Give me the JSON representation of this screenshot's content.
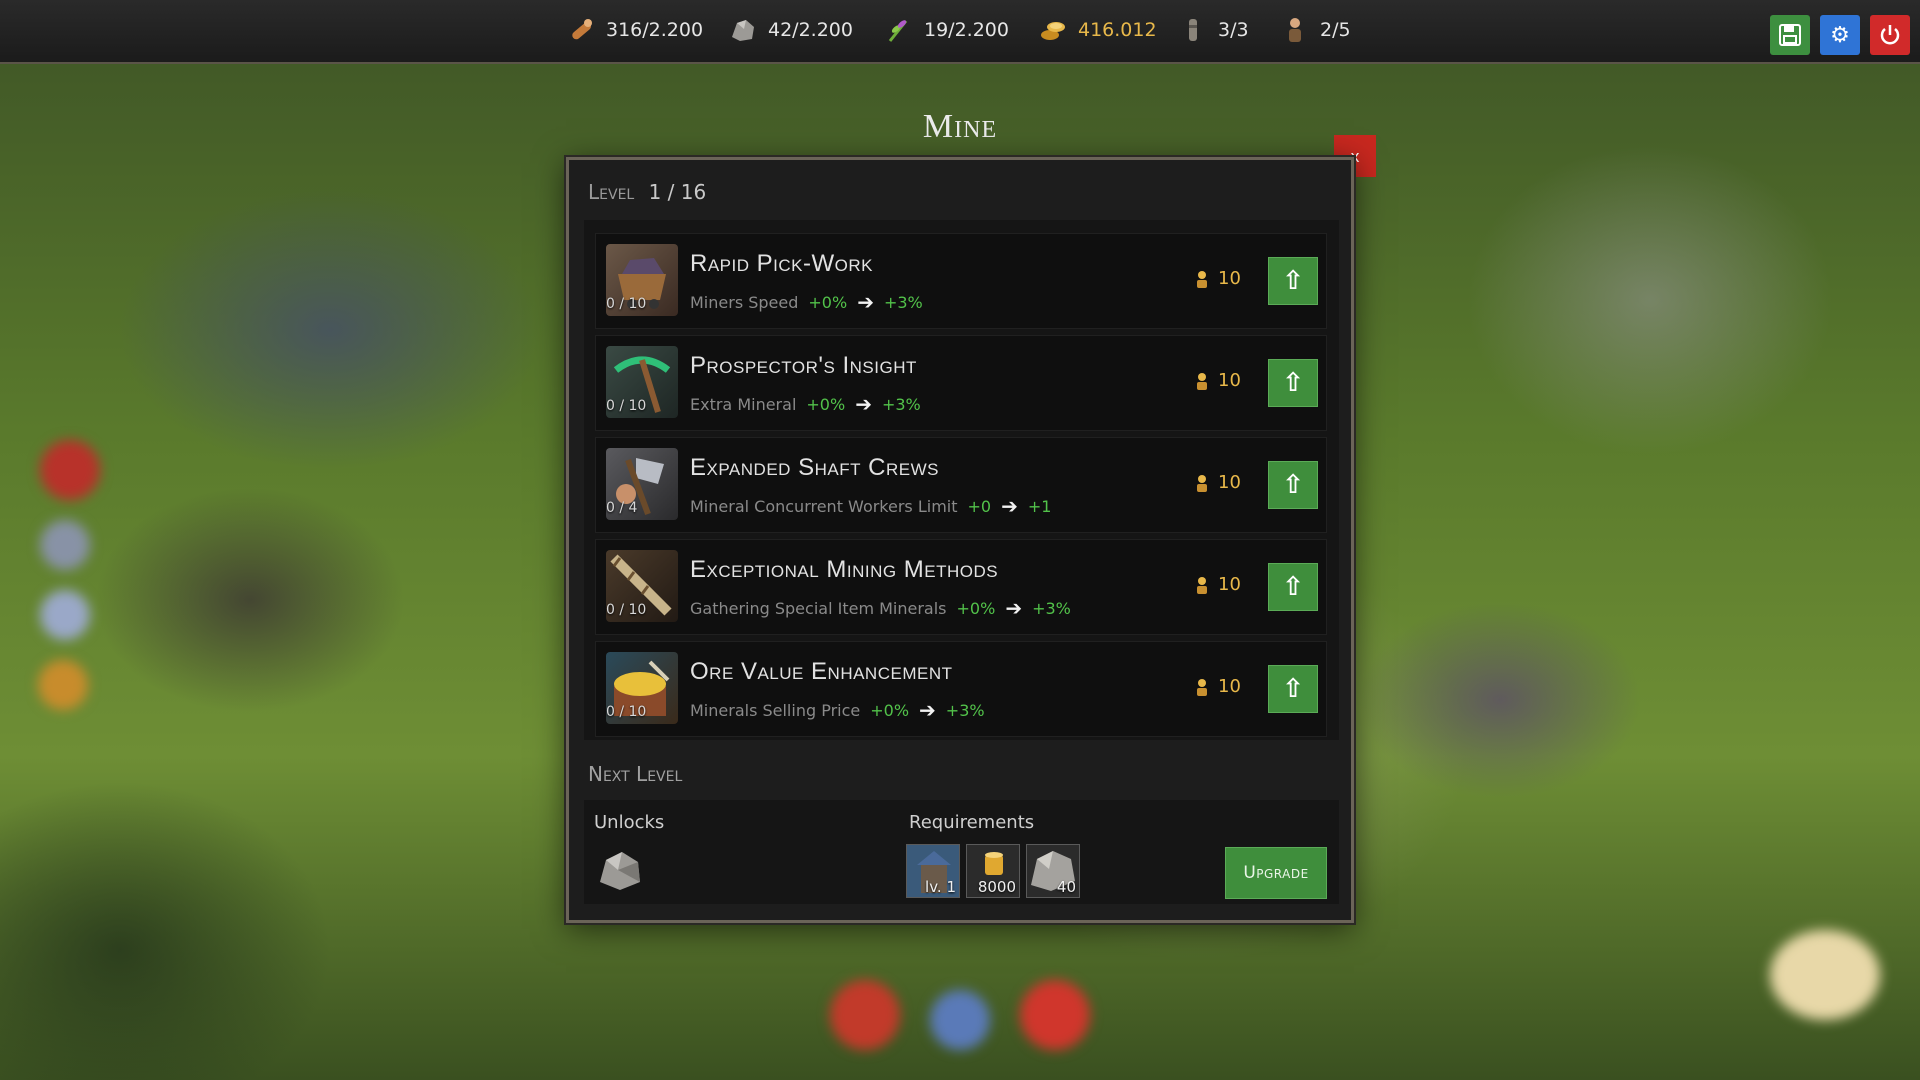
{
  "topbar": {
    "resources": [
      {
        "name": "wood",
        "value": "316/2.200",
        "icon": "wood-log-icon"
      },
      {
        "name": "stone",
        "value": "42/2.200",
        "icon": "stone-icon"
      },
      {
        "name": "herbs",
        "value": "19/2.200",
        "icon": "herb-icon"
      },
      {
        "name": "gold",
        "value": "416.012",
        "icon": "gold-coins-icon"
      },
      {
        "name": "tokens",
        "value": "3/3",
        "icon": "token-icon"
      },
      {
        "name": "workers",
        "value": "2/5",
        "icon": "worker-icon"
      }
    ],
    "buttons": {
      "save": "save-icon",
      "settings": "gear-icon",
      "power": "power-icon"
    },
    "colors": {
      "save": "#3d8f3f",
      "settings": "#2f74d6",
      "power": "#d12a2a",
      "gold_text": "#e8b84a"
    }
  },
  "panel": {
    "title": "Mine",
    "close_label": "x",
    "level_label": "Level",
    "level_value": "1 / 16",
    "skills": [
      {
        "name": "Rapid Pick-Work",
        "count": "0 / 10",
        "stat": "Miners Speed",
        "from": "+0%",
        "to": "+3%",
        "cost": "10"
      },
      {
        "name": "Prospector's Insight",
        "count": "0 / 10",
        "stat": "Extra Mineral",
        "from": "+0%",
        "to": "+3%",
        "cost": "10"
      },
      {
        "name": "Expanded Shaft Crews",
        "count": "0 / 4",
        "stat": "Mineral Concurrent Workers Limit",
        "from": "+0",
        "to": "+1",
        "cost": "10"
      },
      {
        "name": "Exceptional Mining Methods",
        "count": "0 / 10",
        "stat": "Gathering Special Item Minerals",
        "from": "+0%",
        "to": "+3%",
        "cost": "10"
      },
      {
        "name": "Ore Value Enhancement",
        "count": "0 / 10",
        "stat": "Minerals Selling Price",
        "from": "+0%",
        "to": "+3%",
        "cost": "10"
      }
    ],
    "next_level_label": "Next Level",
    "unlocks_label": "Unlocks",
    "requirements_label": "Requirements",
    "requirements": [
      {
        "value": "lv. 1",
        "icon": "building-icon"
      },
      {
        "value": "8000",
        "icon": "gold-coins-icon"
      },
      {
        "value": "40",
        "icon": "stone-icon"
      }
    ],
    "upgrade_label": "Upgrade",
    "arrow_glyph": "➔",
    "up_glyph": "⇧"
  }
}
